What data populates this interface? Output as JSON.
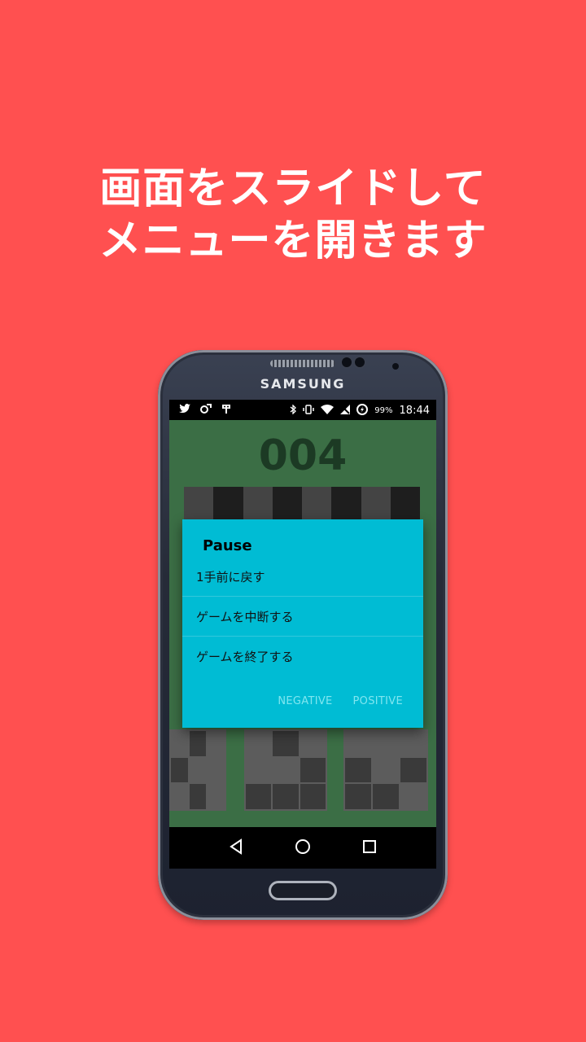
{
  "headline": {
    "line1": "画面をスライドして",
    "line2": "メニューを開きます"
  },
  "device": {
    "brand": "SAMSUNG"
  },
  "statusbar": {
    "battery": "99%",
    "time": "18:44",
    "left_icons": [
      "twitter-icon",
      "notification-icon",
      "notification-icon"
    ],
    "right_icons": [
      "bluetooth-icon",
      "vibrate-icon",
      "wifi-icon",
      "no-signal-icon",
      "data-saver-icon"
    ]
  },
  "game": {
    "counter": "004",
    "board_colors": [
      "#444444",
      "#1e1e1e",
      "#444444",
      "#1e1e1e",
      "#444444",
      "#1e1e1e",
      "#444444",
      "#1e1e1e"
    ]
  },
  "dialog": {
    "title": "Pause",
    "items": [
      {
        "label": "1手前に戻す"
      },
      {
        "label": "ゲームを中断する"
      },
      {
        "label": "ゲームを終了する"
      }
    ],
    "negative": "NEGATIVE",
    "positive": "POSITIVE"
  },
  "navbar": {
    "icons": [
      "back-icon",
      "home-icon",
      "recents-icon"
    ]
  },
  "colors": {
    "background": "#ff5050",
    "game_bg": "#3b6e45",
    "dialog_bg": "#00bcd4"
  }
}
